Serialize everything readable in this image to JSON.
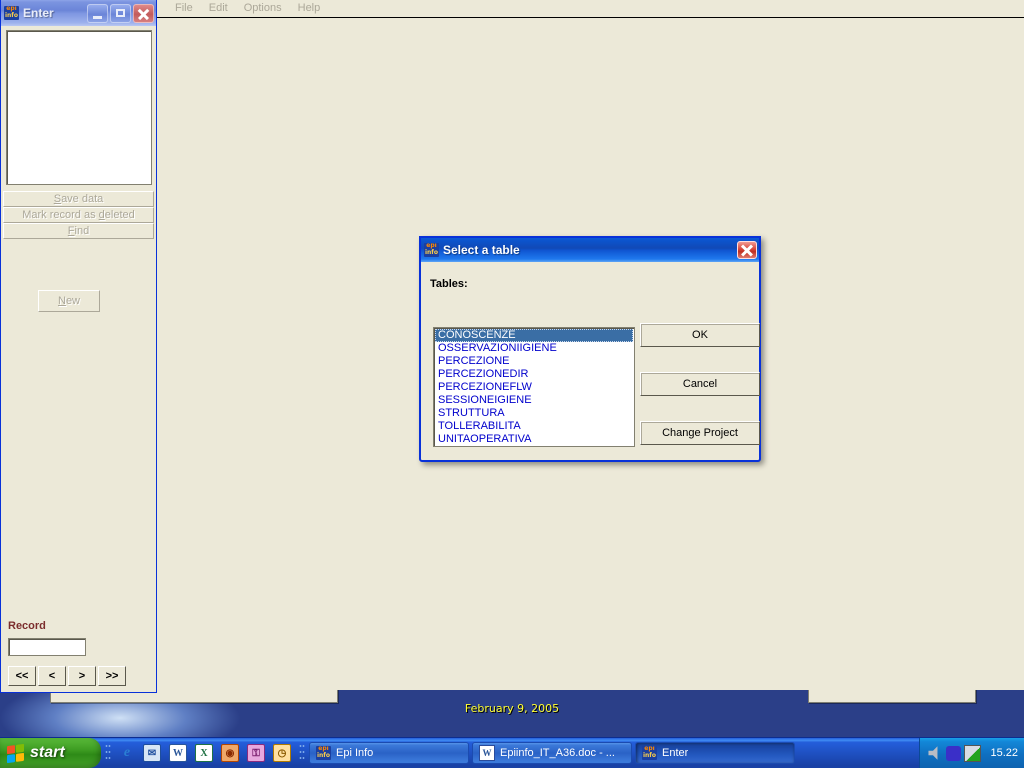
{
  "desktop": {
    "wallpaper_date": "February 9, 2005"
  },
  "enter_window": {
    "title": "Enter",
    "icon": "epiinfo-icon",
    "minimize_label": "Minimize",
    "maximize_label": "Maximize",
    "close_label": "Close",
    "actions": [
      {
        "label_pre": "",
        "accel": "S",
        "label_post": "ave data",
        "name": "save-data-button"
      },
      {
        "label_pre": "Mark record as ",
        "accel": "d",
        "label_post": "eleted",
        "name": "mark-record-deleted-button"
      },
      {
        "label_pre": "",
        "accel": "F",
        "label_post": "ind",
        "name": "find-button"
      }
    ],
    "new_button": {
      "accel": "N",
      "label_post": "ew"
    },
    "record_label": "Record",
    "record_value": "",
    "record_placeholder": "",
    "nav_buttons": [
      "<<",
      "<",
      ">",
      ">>"
    ]
  },
  "main_window": {
    "menu": [
      "File",
      "Edit",
      "Options",
      "Help"
    ]
  },
  "dialog": {
    "title": "Select a table",
    "icon": "epiinfo-icon",
    "close_label": "Close",
    "tables_label": "Tables:",
    "tables": [
      "CONOSCENZE",
      "OSSERVAZIONIIGIENE",
      "PERCEZIONE",
      "PERCEZIONEDIR",
      "PERCEZIONEFLW",
      "SESSIONEIGIENE",
      "STRUTTURA",
      "TOLLERABILITA",
      "UNITAOPERATIVA"
    ],
    "selected_index": 0,
    "buttons": {
      "ok": "OK",
      "cancel": "Cancel",
      "change_project": "Change Project"
    }
  },
  "taskbar": {
    "start_label": "start",
    "quicklaunch": [
      {
        "name": "internet-explorer-icon",
        "glyph": "e",
        "color": "#1a6fc4",
        "bg": "transparent",
        "fg": "#2a7fd4"
      },
      {
        "name": "outlook-express-icon",
        "glyph": "✉",
        "color": "#2a5699",
        "bg": "#d8e6f5",
        "fg": "#1f4e9c"
      },
      {
        "name": "word-icon",
        "glyph": "W",
        "color": "#2a5699",
        "bg": "#ffffff",
        "fg": "#2a5699"
      },
      {
        "name": "excel-icon",
        "glyph": "X",
        "color": "#1f7244",
        "bg": "#ffffff",
        "fg": "#1f7244"
      },
      {
        "name": "media-player-icon",
        "glyph": "◉",
        "color": "#d35400",
        "bg": "#f0a868",
        "fg": "#8a2b00"
      },
      {
        "name": "key-icon",
        "glyph": "⚿",
        "color": "#b33aa3",
        "bg": "#e8a8de",
        "fg": "#7a1f6e"
      },
      {
        "name": "clock-icon",
        "glyph": "◷",
        "color": "#c8860a",
        "bg": "#ffe0a0",
        "fg": "#8a5a00"
      }
    ],
    "tasks": [
      {
        "label": "Epi Info",
        "icon": "epiinfo-icon",
        "active": false
      },
      {
        "label": "Epiinfo_IT_A36.doc - ...",
        "icon": "word-icon",
        "active": false
      },
      {
        "label": "Enter",
        "icon": "epiinfo-icon",
        "active": true
      }
    ],
    "tray": {
      "icons": [
        "volume-icon",
        "audio-device-icon",
        "network-icon"
      ],
      "clock": "15.22"
    }
  }
}
